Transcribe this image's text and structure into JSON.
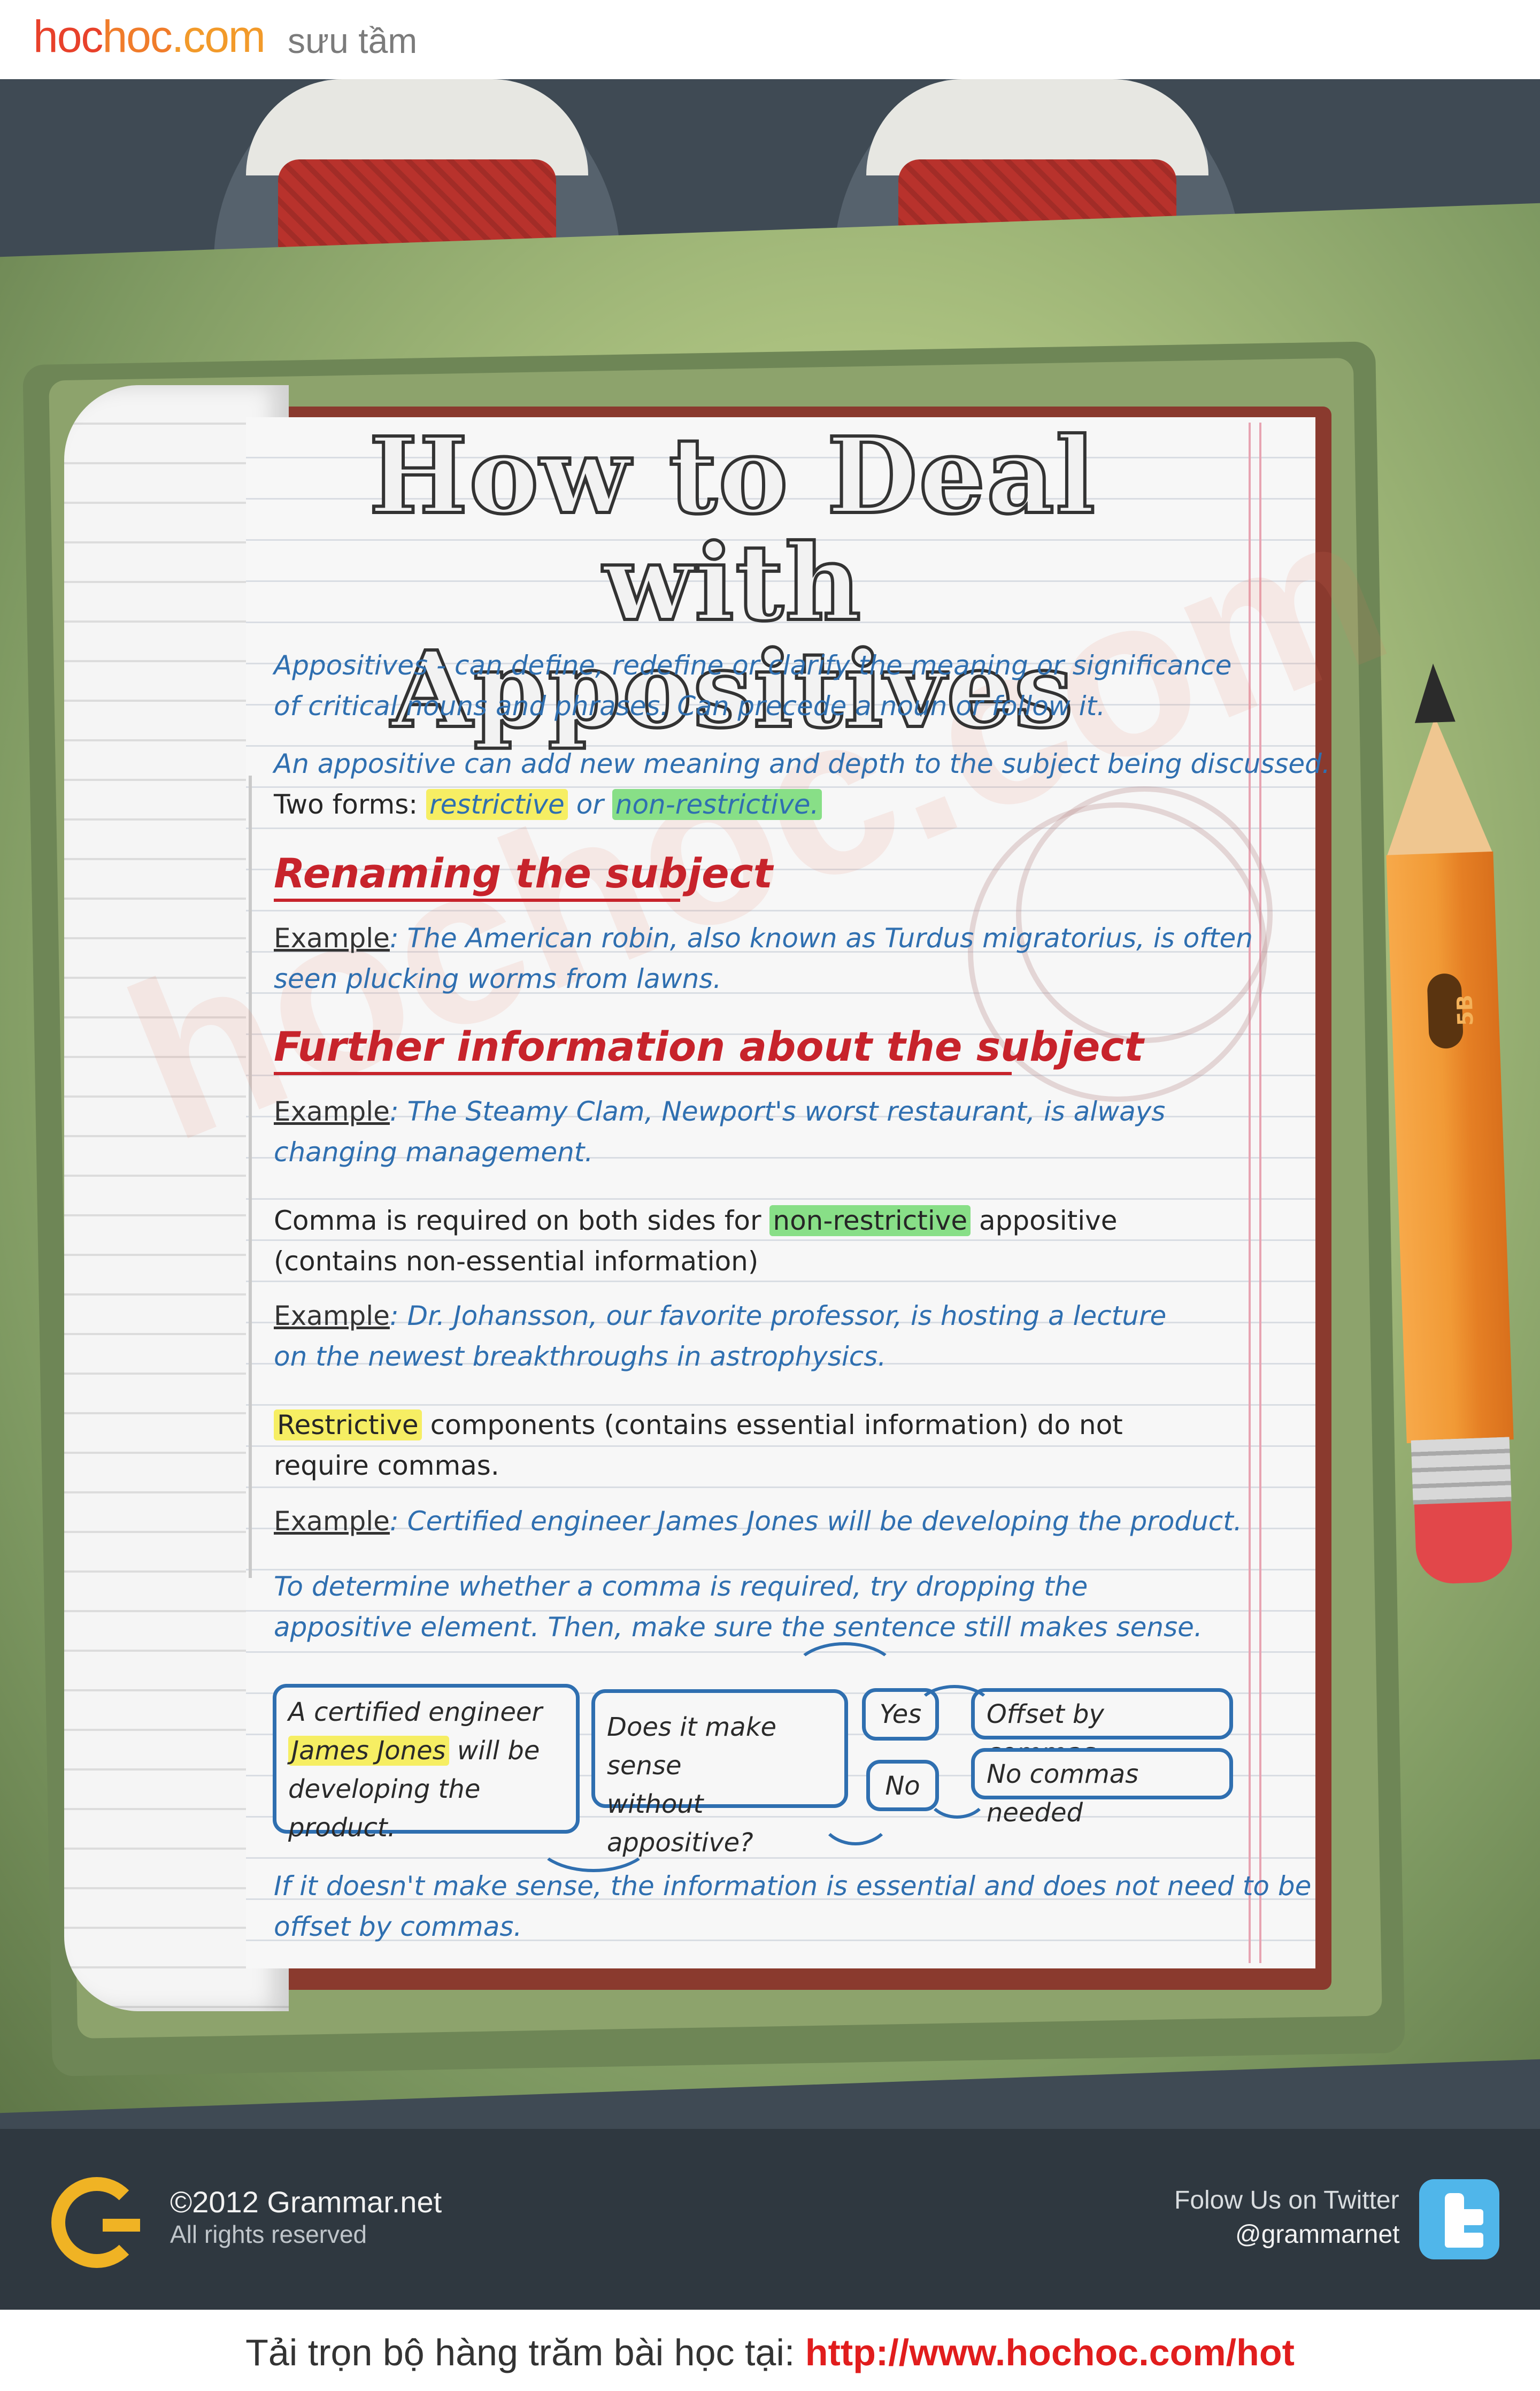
{
  "header": {
    "logo_part1": "hoc",
    "logo_part2": "hoc",
    "logo_dot": ".com",
    "tagline": "sưu tầm"
  },
  "watermark": "hochoc.com",
  "title": {
    "line1": "How to Deal with",
    "line2": "Appositives"
  },
  "intro": {
    "p1_l1": "Appositives - can define, redefine or clarify the meaning or significance",
    "p1_l2": "of critical nouns and phrases. Can precede a noun or follow it.",
    "p2_l1": "An appositive can add new meaning and depth to the subject being discussed.",
    "p2_prefix": "Two forms:",
    "p2_restrictive": "restrictive",
    "p2_or": "or",
    "p2_nonrestrictive": "non-restrictive."
  },
  "section1": {
    "heading": "Renaming the subject",
    "example_label": "Example",
    "example_l1": ": The American robin, also known as Turdus migratorius, is often",
    "example_l2": "seen plucking worms from lawns."
  },
  "section2": {
    "heading": "Further information about the subject",
    "example_label": "Example",
    "example_l1": ": The Steamy Clam, Newport's worst restaurant, is always",
    "example_l2": "changing management.",
    "comma_pre": "Comma is required on both sides for",
    "comma_hl": "non-restrictive",
    "comma_post": "appositive",
    "comma_l2": "(contains non-essential information)",
    "example2_label": "Example",
    "example2_l1": ": Dr. Johansson, our favorite professor, is hosting a lecture",
    "example2_l2": "on the newest breakthroughs in astrophysics.",
    "restr_hl": "Restrictive",
    "restr_post": "components (contains essential information)  do not",
    "restr_l2": "require commas.",
    "example3_label": "Example",
    "example3_l1": ": Certified engineer James Jones will be developing the product.",
    "tip_l1": "To determine whether a comma is required, try dropping the",
    "tip_l2": "appositive element. Then, make sure the sentence still makes sense."
  },
  "flow": {
    "box1_l1": "A certified engineer",
    "box1_hl": "James Jones",
    "box1_l2_post": "will be",
    "box1_l3": "developing the product.",
    "box2_l1": "Does it make sense",
    "box2_l2": "without appositive?",
    "yes": "Yes",
    "no": "No",
    "offset": "Offset by commas",
    "no_commas": "No commas needed"
  },
  "conclusion": {
    "l1": "If it doesn't make sense, the information is essential and does not need to be",
    "l2": "offset by commas."
  },
  "pencil": {
    "label": "5B"
  },
  "footer": {
    "copyright": "©2012 Grammar.net",
    "rights": "All rights reserved",
    "follow": "Folow Us on Twitter",
    "handle": "@grammarnet"
  },
  "bottom": {
    "prefix": "Tải trọn bộ hàng trăm bài học tại: ",
    "url": "http://www.hochoc.com/hot"
  },
  "colors": {
    "blue_text": "#2f6fb0",
    "heading_red": "#c7232b",
    "highlight_yellow": "#f6ee63",
    "highlight_green": "#88df87"
  }
}
